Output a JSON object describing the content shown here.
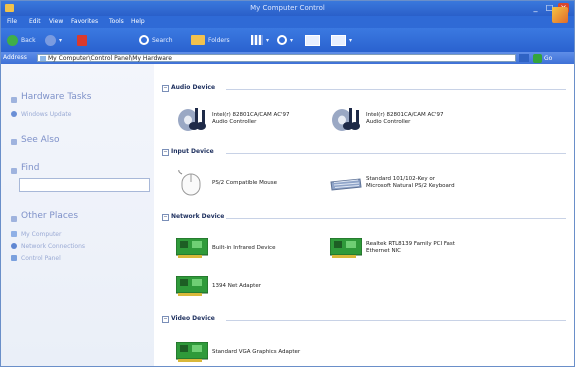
{
  "window": {
    "title": "My Computer Control"
  },
  "menu": [
    "File",
    "Edit",
    "View",
    "Favorites",
    "Tools",
    "Help"
  ],
  "toolbar": {
    "back_label": "Back",
    "search_label": "Search",
    "folders_label": "Folders"
  },
  "address": {
    "label": "Address",
    "value": "My Computer\\Control Panel\\My Hardware",
    "go_label": "Go"
  },
  "sidebar": {
    "hardware_tasks": {
      "heading": "Hardware Tasks",
      "items": [
        "Windows Update"
      ]
    },
    "see_also": {
      "heading": "See Also"
    },
    "find": {
      "heading": "Find",
      "input_value": ""
    },
    "other_places": {
      "heading": "Other Places",
      "items": [
        "My Computer",
        "Network Connections",
        "Control Panel"
      ]
    }
  },
  "groups": [
    {
      "header": "Audio Device",
      "items": [
        {
          "line1": "Intel(r) 82801CA/CAM AC'97",
          "line2": "Audio Controller"
        },
        {
          "line1": "Intel(r) 82801CA/CAM AC'97",
          "line2": "Audio Controller"
        }
      ]
    },
    {
      "header": "Input Device",
      "items": [
        {
          "line1": "PS/2 Compatible Mouse",
          "line2": ""
        },
        {
          "line1": "Standard 101/102-Key or",
          "line2": "Microsoft Natural PS/2 Keyboard"
        }
      ]
    },
    {
      "header": "Network Device",
      "items": [
        {
          "line1": "Built-in Infrared Device",
          "line2": ""
        },
        {
          "line1": "Realtek RTL8139 Family PCI Fast",
          "line2": "Ethernet NIC"
        },
        {
          "line1": "1394 Net Adapter",
          "line2": ""
        }
      ]
    },
    {
      "header": "Video Device",
      "items": [
        {
          "line1": "Standard VGA Graphics Adapter",
          "line2": ""
        }
      ]
    }
  ],
  "colors": {
    "titlebar": "#2a5fc9",
    "sidebar_bg": "#eef2f9",
    "sidebar_heading": "#7e91c9",
    "card_green": "#2f9a3a"
  }
}
